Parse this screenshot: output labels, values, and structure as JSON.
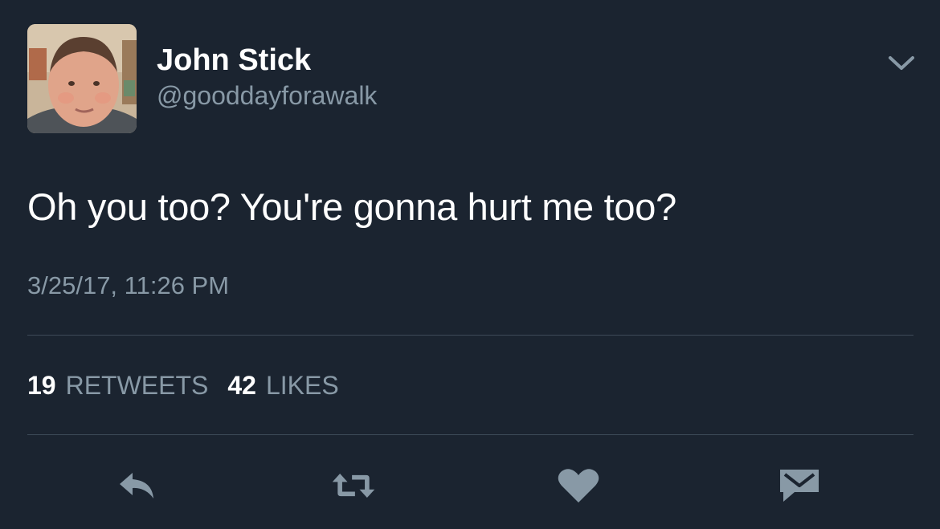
{
  "user": {
    "display_name": "John Stick",
    "handle": "@gooddayforawalk"
  },
  "tweet": {
    "text": "Oh you too? You're gonna hurt me too?",
    "timestamp": "3/25/17, 11:26 PM"
  },
  "stats": {
    "retweets_count": "19",
    "retweets_label": "RETWEETS",
    "likes_count": "42",
    "likes_label": "LIKES"
  },
  "icons": {
    "menu": "chevron-down-icon",
    "reply": "reply-icon",
    "retweet": "retweet-icon",
    "like": "heart-icon",
    "dm": "envelope-icon"
  },
  "colors": {
    "background": "#1b2430",
    "secondary_text": "#8899a6",
    "divider": "#3d4a57"
  }
}
